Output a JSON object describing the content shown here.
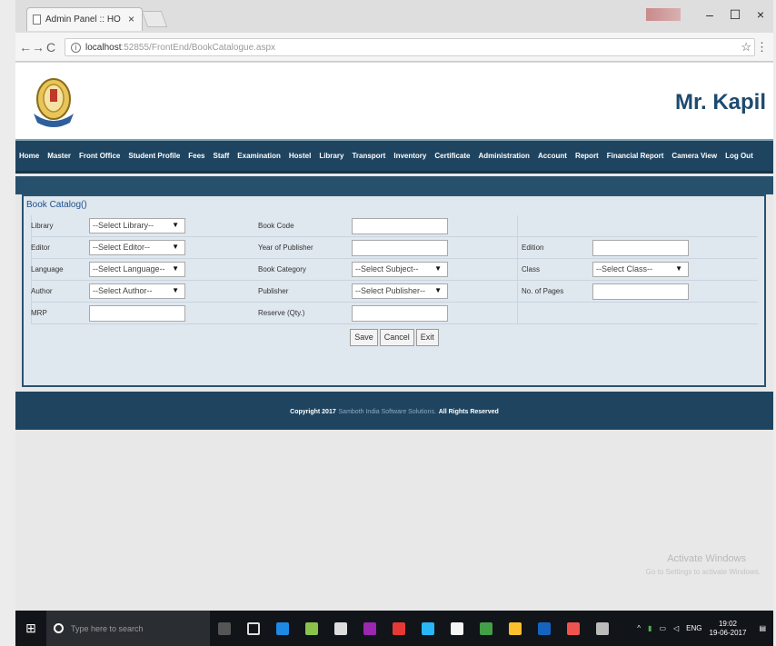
{
  "browser": {
    "tab_title": "Admin Panel :: HO",
    "tab_close": "×",
    "url_host": "localhost",
    "url_rest": ":52855/FrontEnd/BookCatalogue.aspx",
    "window_buttons": [
      "–",
      "☐",
      "×"
    ]
  },
  "header": {
    "username": "Mr. Kapil"
  },
  "nav": {
    "items": [
      "Home",
      "Master",
      "Front Office",
      "Student Profile",
      "Fees",
      "Staff",
      "Examination",
      "Hostel",
      "Library",
      "Transport",
      "Inventory",
      "Certificate",
      "Administration",
      "Account",
      "Report",
      "Financial Report",
      "Camera View",
      "Log Out"
    ]
  },
  "form": {
    "title": "Book Catalog()",
    "library_label": "Library",
    "library_value": "--Select Library--",
    "book_code_label": "Book Code",
    "editor_label": "Editor",
    "editor_value": "--Select Editor--",
    "year_label": "Year of Publisher",
    "edition_label": "Edition",
    "language_label": "Language",
    "language_value": "--Select Language--",
    "category_label": "Book Category",
    "category_value": "--Select Subject--",
    "class_label": "Class",
    "class_value": "--Select Class--",
    "author_label": "Author",
    "author_value": "--Select Author--",
    "publisher_label": "Publisher",
    "publisher_value": "--Select Publisher--",
    "pages_label": "No. of Pages",
    "mrp_label": "MRP",
    "reserve_label": "Reserve (Qty.)",
    "save_label": "Save",
    "cancel_label": "Cancel",
    "exit_label": "Exit"
  },
  "footer": {
    "copyright": "Copyright 2017",
    "company": "Samboth India Software Solutions.",
    "rights": "All Rights Reserved"
  },
  "watermark": {
    "line1": "Activate Windows",
    "line2": "Go to Settings to activate Windows."
  },
  "taskbar": {
    "search_placeholder": "Type here to search",
    "lang": "ENG",
    "time": "19:02",
    "date": "19-06-2017"
  }
}
